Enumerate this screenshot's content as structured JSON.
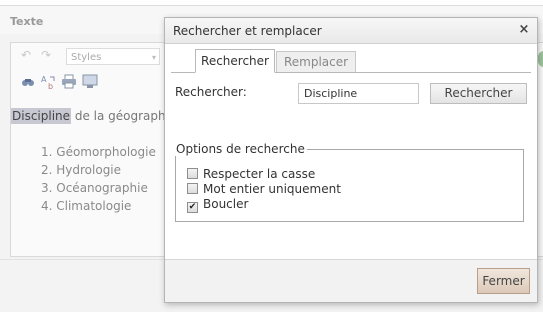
{
  "panel": {
    "title": "Texte"
  },
  "editor": {
    "styles_select": "Styles",
    "highlighted_word": "Discipline",
    "line_rest": " de la géographie",
    "list_items": [
      "1. Géomorphologie",
      "2. Hydrologie",
      "3. Océanographie",
      "4. Climatologie"
    ],
    "icons": [
      "undo-icon",
      "redo-icon",
      "find-icon",
      "replace-icon",
      "print-icon",
      "preview-icon"
    ]
  },
  "dialog": {
    "title": "Rechercher et remplacer",
    "close_glyph": "×",
    "tabs": [
      {
        "label": "Rechercher",
        "active": true
      },
      {
        "label": "Remplacer",
        "active": false
      }
    ],
    "find_label": "Rechercher:",
    "find_value": "Discipline",
    "find_button": "Rechercher",
    "options_legend": "Options de recherche",
    "options": [
      {
        "label": "Respecter la casse",
        "checked": false
      },
      {
        "label": "Mot entier uniquement",
        "checked": false
      },
      {
        "label": "Boucler",
        "checked": true
      }
    ],
    "close_button": "Fermer"
  },
  "colors": {
    "highlight": "#c8c8d2",
    "dialog_border": "#b5b5b5",
    "footer_button": "#dcc9b8"
  }
}
